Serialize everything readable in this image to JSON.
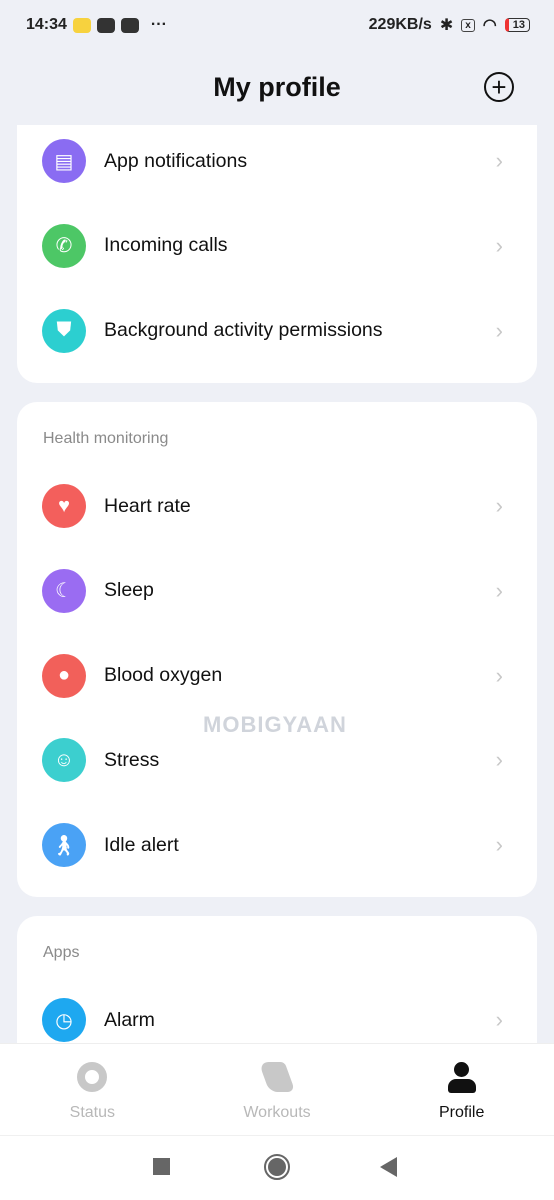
{
  "status_bar": {
    "time": "14:34",
    "more": "···",
    "speed": "229KB/s",
    "battery": "13"
  },
  "header": {
    "title": "My profile",
    "add_icon": "plus-circle-icon"
  },
  "cards": [
    {
      "label": "",
      "items": [
        {
          "label": "App notifications",
          "icon": "message-icon",
          "color": "#8a6cf2"
        },
        {
          "label": "Incoming calls",
          "icon": "phone-icon",
          "color": "#4dc766"
        },
        {
          "label": "Background activity permissions",
          "icon": "shield-icon",
          "color": "#2ccfd0"
        }
      ]
    },
    {
      "label": "Health monitoring",
      "items": [
        {
          "label": "Heart rate",
          "icon": "heart-icon",
          "color": "#f35f5c"
        },
        {
          "label": "Sleep",
          "icon": "moon-icon",
          "color": "#9a6cf2"
        },
        {
          "label": "Blood oxygen",
          "icon": "drop-icon",
          "color": "#f2605a"
        },
        {
          "label": "Stress",
          "icon": "face-icon",
          "color": "#3ccfcf"
        },
        {
          "label": "Idle alert",
          "icon": "walking-icon",
          "color": "#4aa2f5"
        }
      ]
    },
    {
      "label": "Apps",
      "items": [
        {
          "label": "Alarm",
          "icon": "alarm-icon",
          "color": "#1ea8f0"
        }
      ]
    }
  ],
  "watermark": "MOBIGYAAN",
  "tabs": [
    {
      "label": "Status",
      "active": false
    },
    {
      "label": "Workouts",
      "active": false
    },
    {
      "label": "Profile",
      "active": true
    }
  ]
}
